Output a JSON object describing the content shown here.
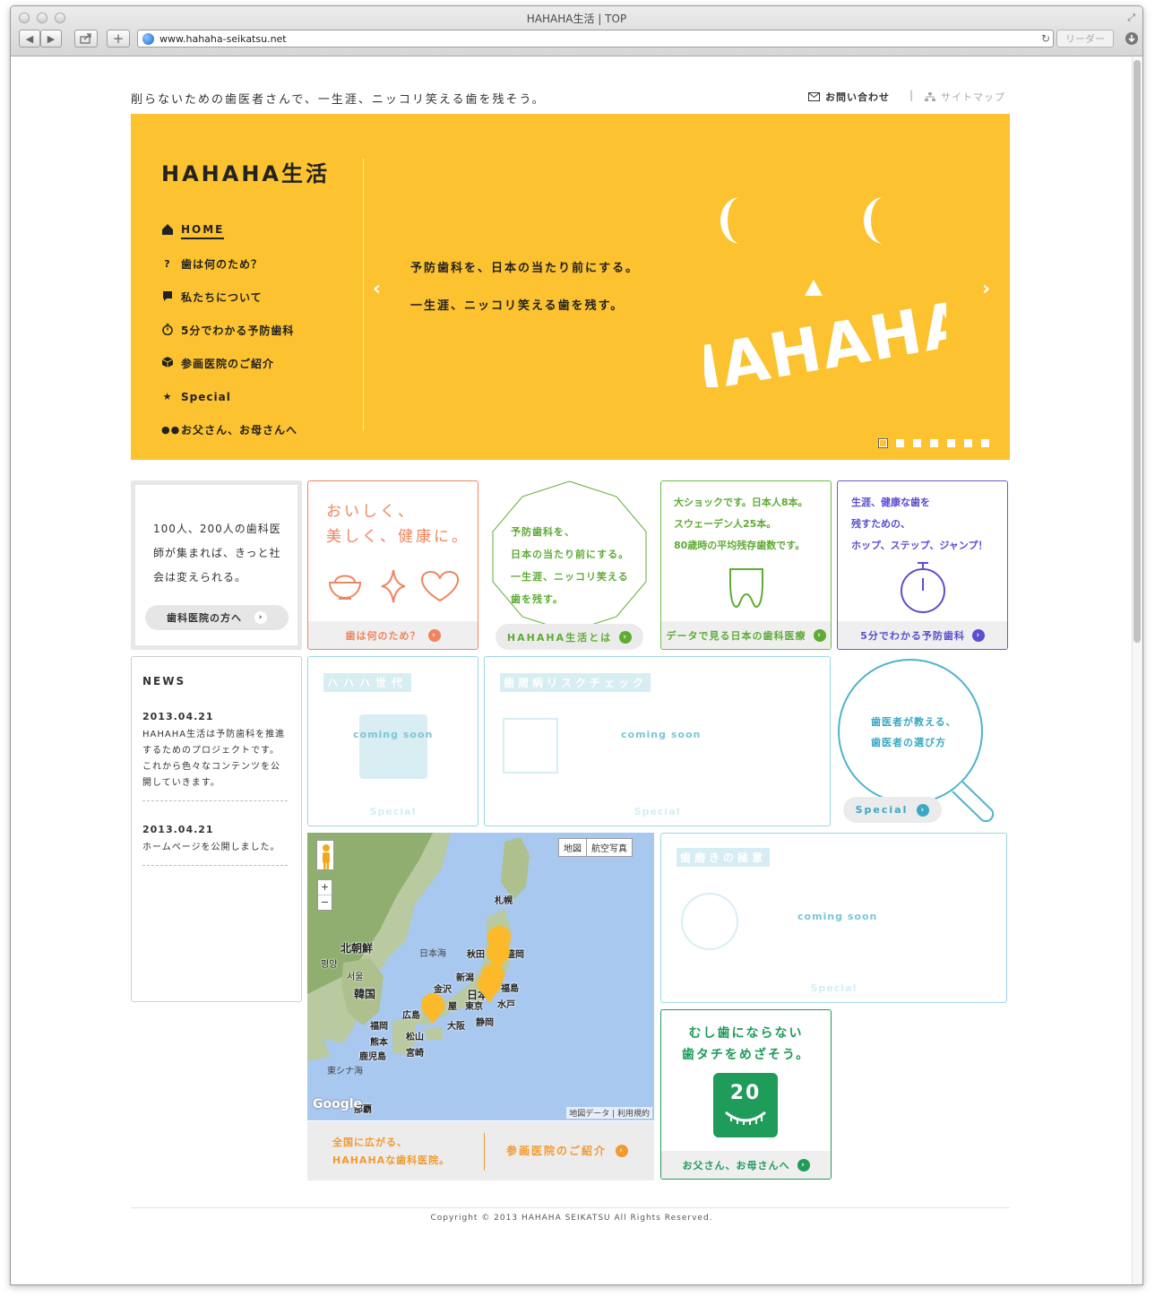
{
  "browser": {
    "window_title": "HAHAHA生活 | TOP",
    "url": "www.hahaha-seikatsu.net",
    "reader_label": "リーダー",
    "nav_back": "◀",
    "nav_forward": "▶",
    "add_tab": "+"
  },
  "header": {
    "tagline": "削らないための歯医者さんで、一生涯、ニッコリ笑える歯を残そう。",
    "contact_label": "お問い合わせ",
    "separator": "|",
    "sitemap_label": "サイトマップ"
  },
  "hero": {
    "logo": "HAHAHA生活",
    "menu": [
      {
        "label": "HOME",
        "icon": "home-icon"
      },
      {
        "label": "歯は何のため？",
        "icon": "question-icon"
      },
      {
        "label": "私たちについて",
        "icon": "speech-bubble-icon"
      },
      {
        "label": "5分でわかる予防歯科",
        "icon": "stopwatch-icon"
      },
      {
        "label": "参画医院のご紹介",
        "icon": "cube-icon"
      },
      {
        "label": "Special",
        "icon": "star-icon"
      },
      {
        "label": "お父さん、お母さんへ",
        "icon": "two-dots-icon"
      }
    ],
    "copy_line1": "予防歯科を、日本の当たり前にする。",
    "copy_line2": "一生涯、ニッコリ笑える歯を残す。",
    "face_text": "HAHAHA",
    "arrow_prev": "‹",
    "arrow_next": "›",
    "slide_count": 7,
    "active_slide": 1
  },
  "tiles": {
    "clinic": {
      "text": "100人、200人の歯科医師が集まれば、きっと社会は変えられる。",
      "button": "歯科医院の方へ"
    },
    "why": {
      "title_line1": "おいしく、",
      "title_line2": "美しく、健康に。",
      "footer": "歯は何のため？"
    },
    "about": {
      "line1": "予防歯科を、",
      "line2": "日本の当たり前にする。",
      "line3": "一生涯、ニッコリ笑える",
      "line4": "歯を残す。",
      "button": "HAHAHA生活とは"
    },
    "data": {
      "line1": "大ショックです。日本人8本。",
      "line2": "スウェーデン人25本。",
      "line3": "80歳時の平均残存歯数です。",
      "footer": "データで見る日本の歯科医療"
    },
    "five": {
      "line1": "生涯、健康な歯を",
      "line2": "残すための、",
      "line3": "ホップ、ステップ、ジャンプ！",
      "footer": "5分でわかる予防歯科"
    },
    "soon1": {
      "coming": "coming soon",
      "footer": "Special",
      "header_text": "ハハハ世代"
    },
    "soon2": {
      "coming": "coming soon",
      "footer": "Special",
      "header_text": "歯周病リスクチェック"
    },
    "soon3": {
      "coming": "coming soon",
      "footer": "Special",
      "header_text": "歯磨きの極意"
    },
    "choose": {
      "line1": "歯医者が教える、",
      "line2": "歯医者の選び方",
      "button": "Special"
    },
    "parents": {
      "line1": "むし歯にならない",
      "line2": "歯タチをめざそう。",
      "badge": "20",
      "footer": "お父さん、お母さんへ"
    }
  },
  "news": {
    "title": "NEWS",
    "items": [
      {
        "date": "2013.04.21",
        "text": "HAHAHA生活は予防歯科を推進するためのプロジェクトです。これから色々なコンテンツを公開していきます。"
      },
      {
        "date": "2013.04.21",
        "text": "ホームページを公開しました。"
      }
    ]
  },
  "map": {
    "type_map": "地図",
    "type_satellite": "航空写真",
    "zoom_in": "+",
    "zoom_out": "−",
    "labels": {
      "sapporo": "札幌",
      "north_korea": "北朝鮮",
      "sea_of_japan": "日本海",
      "akita": "秋田",
      "morioka": "盛岡",
      "pyongyang": "평양",
      "seoul": "서울",
      "korea": "韓国",
      "niigata": "新潟",
      "fukushima": "福島",
      "kanazawa": "金沢",
      "japan": "日本",
      "hiroshima": "広島",
      "nagoya": "屋",
      "tokyo": "東京",
      "mito": "水戸",
      "fukuoka": "福岡",
      "osaka": "大阪",
      "shizuoka": "静岡",
      "kumamoto": "熊本",
      "matsuyama": "松山",
      "kagoshima": "鹿児島",
      "miyazaki": "宮崎",
      "east_china_sea": "東シナ海",
      "naha": "那覇"
    },
    "google": "Google",
    "attribution": "地図データ | 利用規約",
    "footer_line1": "全国に広がる、",
    "footer_line2": "HAHAHAな歯科医院。",
    "footer_link": "参画医院のご紹介"
  },
  "footer": {
    "copyright": "Copyright © 2013 HAHAHA SEIKATSU All Rights Reserved."
  },
  "colors": {
    "brand_yellow": "#fcc22f",
    "orange": "#f0845e",
    "green": "#5fab34",
    "purple": "#5a4fcf",
    "cyan": "#3aa8c4",
    "dark_green": "#1f9b5a"
  }
}
